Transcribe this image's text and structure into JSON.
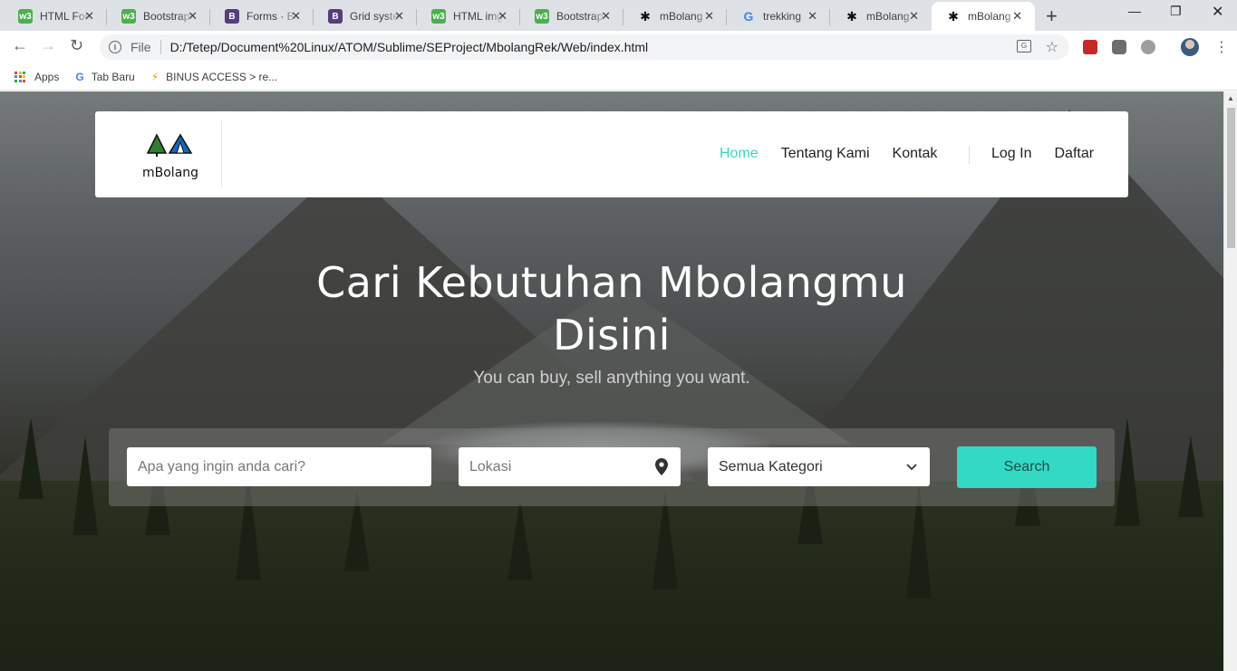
{
  "browser": {
    "tabs": [
      {
        "title": "HTML Forms",
        "favicon": "w3schools-icon"
      },
      {
        "title": "Bootstrap",
        "favicon": "w3schools-icon"
      },
      {
        "title": "Forms · Bootstrap",
        "favicon": "bootstrap-icon"
      },
      {
        "title": "Grid system",
        "favicon": "bootstrap-icon"
      },
      {
        "title": "HTML img",
        "favicon": "w3schools-icon"
      },
      {
        "title": "Bootstrap",
        "favicon": "w3schools-icon"
      },
      {
        "title": "mBolang",
        "favicon": "mbolang-icon"
      },
      {
        "title": "trekking",
        "favicon": "google-icon"
      },
      {
        "title": "mBolang",
        "favicon": "mbolang-icon"
      },
      {
        "title": "mBolang",
        "favicon": "mbolang-icon"
      }
    ],
    "address": {
      "scheme_label": "File",
      "url": "D:/Tetep/Document%20Linux/ATOM/Sublime/SEProject/MbolangRek/Web/index.html"
    },
    "bookmarks": [
      {
        "label": "Apps"
      },
      {
        "label": "Tab Baru"
      },
      {
        "label": "BINUS ACCESS > re..."
      }
    ]
  },
  "page": {
    "logo_text": "mBolang",
    "nav": {
      "home": "Home",
      "about": "Tentang Kami",
      "contact": "Kontak",
      "login": "Log In",
      "register": "Daftar"
    },
    "hero": {
      "title": "Cari Kebutuhan Mbolangmu Disini",
      "subtitle": "You can buy, sell anything you want."
    },
    "search": {
      "query_placeholder": "Apa yang ingin anda cari?",
      "location_placeholder": "Lokasi",
      "category_selected": "Semua Kategori",
      "button_label": "Search"
    },
    "colors": {
      "accent": "#33d9c4",
      "nav_active": "#3dd3c0"
    }
  }
}
